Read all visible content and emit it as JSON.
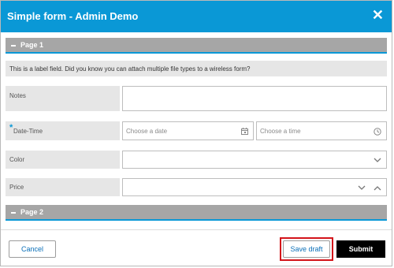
{
  "dialog": {
    "title": "Simple form - Admin Demo",
    "close_icon": "close-icon"
  },
  "sections": [
    {
      "label": "Page 1",
      "icon": "collapse-dash-icon"
    },
    {
      "label": "Page 2",
      "icon": "collapse-dash-icon"
    }
  ],
  "label_field": {
    "text": "This is a label field. Did you know you can attach multiple file types to a wireless form?"
  },
  "fields": {
    "notes": {
      "label": "Notes",
      "value": ""
    },
    "datetime": {
      "label": "Date-Time",
      "required_marker": "*",
      "date_placeholder": "Choose a date",
      "date_icon": "calendar-icon",
      "time_placeholder": "Choose a time",
      "time_icon": "clock-icon"
    },
    "color": {
      "label": "Color",
      "value": "",
      "icon": "chevron-down-icon"
    },
    "price": {
      "label": "Price",
      "value": "",
      "icons": [
        "chevron-down-icon",
        "chevron-up-icon"
      ]
    }
  },
  "footer": {
    "cancel_label": "Cancel",
    "save_draft_label": "Save draft",
    "submit_label": "Submit"
  },
  "colors": {
    "title_bar": "#0a98d6",
    "section_bar": "#a6a6a6",
    "highlight_outline": "#d3141a",
    "submit_bg": "#000000"
  }
}
